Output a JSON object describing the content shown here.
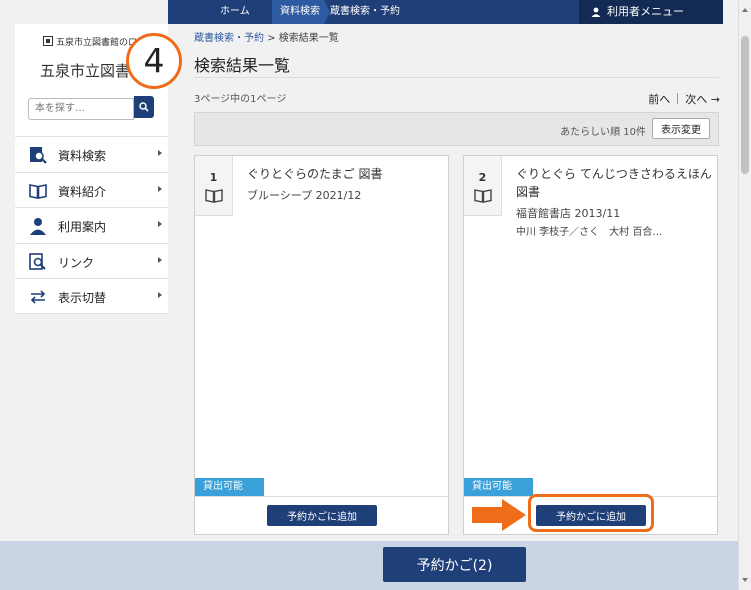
{
  "topnav": {
    "home": "ホーム",
    "materials": "資料検索",
    "current": "蔵書検索・予約",
    "user_menu": "利用者メニュー"
  },
  "sidebar": {
    "logo_text": "五泉市立図書館のロ",
    "site_name": "五泉市立図書館",
    "search_placeholder": "本を探す…",
    "items": [
      {
        "label": "資料検索",
        "icon": "search-book-icon"
      },
      {
        "label": "資料紹介",
        "icon": "open-book-icon"
      },
      {
        "label": "利用案内",
        "icon": "person-icon"
      },
      {
        "label": "リンク",
        "icon": "link-icon"
      },
      {
        "label": "表示切替",
        "icon": "switch-arrows-icon"
      }
    ]
  },
  "step_number": "4",
  "main": {
    "breadcrumb_link": "蔵書検索・予約",
    "breadcrumb_sep": ">",
    "breadcrumb_current": "検索結果一覧",
    "title": "検索結果一覧",
    "page_count": "3ページ中の1ページ",
    "prev": "前へ",
    "next": "次へ →",
    "sort_label": "あたらしい順 10件",
    "sort_button": "表示変更"
  },
  "results": [
    {
      "index": "1",
      "title": "ぐりとぐらのたまご 図書",
      "publisher": "ブルーシープ 2021/12",
      "author": "",
      "status": "貸出可能",
      "action": "予約かごに追加"
    },
    {
      "index": "2",
      "title": "ぐりとぐら てんじつきさわるえほん 図書",
      "publisher": "福音館書店 2013/11",
      "author": "中川 李枝子／さく　大村 百合…",
      "status": "貸出可能",
      "action": "予約かごに追加"
    }
  ],
  "cart_button": "予約かご(2)",
  "colors": {
    "navy": "#1f3f78",
    "accent_orange": "#ef6c1a",
    "status_blue": "#3aa0d9"
  }
}
